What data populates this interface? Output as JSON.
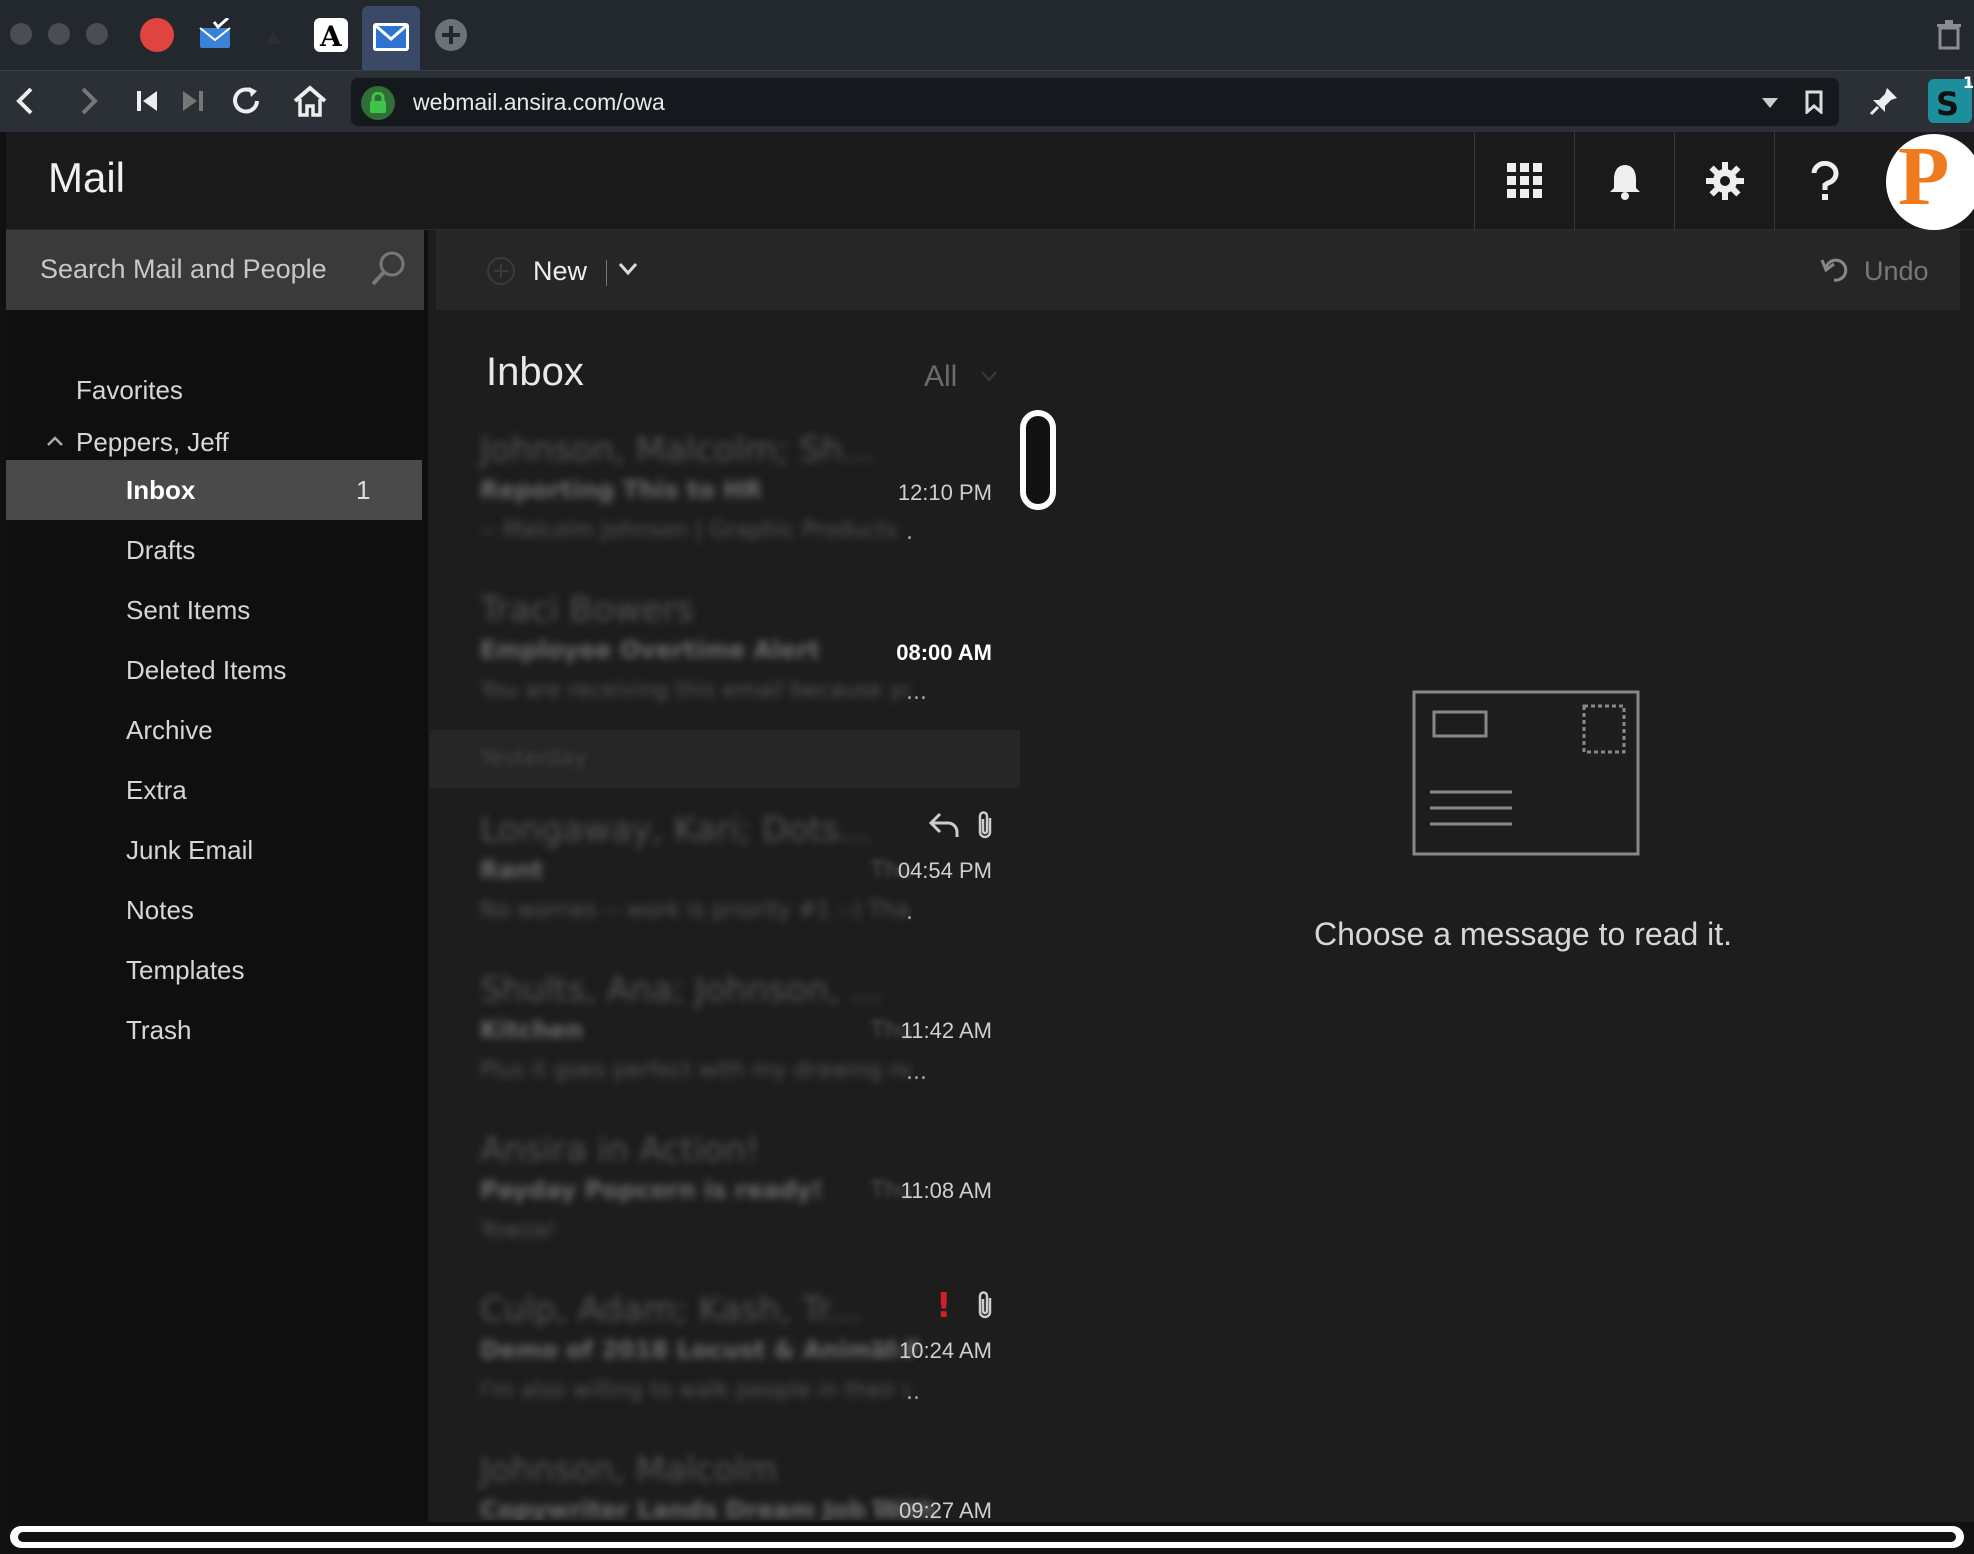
{
  "browser": {
    "url": "webmail.ansira.com/owa",
    "extension_badge": "1"
  },
  "app": {
    "title": "Mail",
    "avatar_letter": "P"
  },
  "search": {
    "placeholder": "Search Mail and People"
  },
  "sidebar": {
    "favorites": "Favorites",
    "account": "Peppers, Jeff",
    "folders": [
      {
        "label": "Inbox",
        "count": "1",
        "active": true
      },
      {
        "label": "Drafts"
      },
      {
        "label": "Sent Items"
      },
      {
        "label": "Deleted Items"
      },
      {
        "label": "Archive"
      },
      {
        "label": "Extra"
      },
      {
        "label": "Junk Email"
      },
      {
        "label": "Notes"
      },
      {
        "label": "Templates"
      },
      {
        "label": "Trash"
      }
    ]
  },
  "toolbar": {
    "new_label": "New",
    "undo_label": "Undo"
  },
  "list": {
    "title": "Inbox",
    "filter": "All",
    "messages": [
      {
        "from": "Johnson, Malcolm; Sh...",
        "subject": "Reporting This to HR",
        "preview": "-- Malcolm Johnson | Graphic Products",
        "time": "12:10 PM",
        "dots": "."
      },
      {
        "from": "Traci Bowers",
        "subject": "Employee Overtime Alert",
        "preview": "You are receiving this email because you",
        "time": "08:00 AM",
        "dots": "...",
        "unread": true
      },
      {
        "from": "Longaway, Kari; Dots...",
        "subject": "Rant",
        "preview": "No worries -- work is priority #1 :-) Tha",
        "time": "04:54 PM",
        "day": "Thu",
        "dots": "."
      },
      {
        "from": "Shults, Ana; Johnson, ...",
        "subject": "Kitchen",
        "preview": "Plus it goes perfect with my drawing next",
        "time": "11:42 AM",
        "day": "Thu",
        "dots": "..."
      },
      {
        "from": "Ansira in Action!",
        "subject": "Payday Popcorn is ready!",
        "preview": "Yowza!",
        "time": "11:08 AM",
        "day": "Thu"
      },
      {
        "from": "Culp, Adam; Kash, Tr...",
        "subject": "Demo of 2018 Locust & Animal F",
        "preview": "I'm also willing to walk people in their ca",
        "time": "10:24 AM",
        "day": "Thu",
        "dots": ".."
      },
      {
        "from": "Johnson, Malcolm",
        "subject": "Copywriter Lands Dream Job With",
        "preview": "",
        "time": "09:27 AM",
        "day": "Thu"
      }
    ],
    "group_header": "Yesterday"
  },
  "reading_pane": {
    "empty_text": "Choose a message to read it."
  }
}
